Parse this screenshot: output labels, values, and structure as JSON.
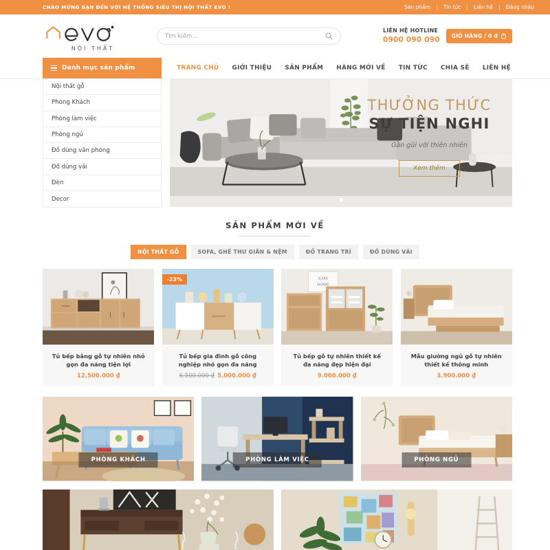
{
  "topbar": {
    "welcome": "CHÀO MỪNG BẠN ĐẾN VỚI HỆ THỐNG SIÊU THỊ NỘI THẤT EVO !",
    "links": [
      "Sản phẩm",
      "Tin tức",
      "Liên hệ",
      "Đăng nhập"
    ]
  },
  "header": {
    "logo_text": "evo",
    "logo_sub": "NỘI THẤT",
    "logo_icon": "house-icon",
    "search_placeholder": "Tìm kiếm...",
    "search_value": "",
    "search_icon": "search-icon",
    "hotline_label": "LIÊN HỆ HOTLINE",
    "hotline_number": "0900 090 090",
    "cart_label": "GIỎ HÀNG / 0 đ",
    "cart_icon": "shopping-bag-icon"
  },
  "sidebar": {
    "title": "Danh mục sản phẩm",
    "menu_icon": "hamburger-icon",
    "items": [
      "Nội thất gỗ",
      "Phòng Khách",
      "Phòng làm việc",
      "Phòng ngủ",
      "Đồ dùng văn phòng",
      "Đồ dùng vải",
      "Đèn",
      "Decor"
    ]
  },
  "nav": {
    "items": [
      {
        "label": "TRANG CHỦ",
        "active": true
      },
      {
        "label": "GIỚI THIỆU",
        "active": false
      },
      {
        "label": "SẢN PHẨM",
        "active": false
      },
      {
        "label": "HÀNG MỚI VỀ",
        "active": false
      },
      {
        "label": "TIN TỨC",
        "active": false
      },
      {
        "label": "CHIA SẺ",
        "active": false
      },
      {
        "label": "LIÊN HỆ",
        "active": false
      }
    ]
  },
  "banner": {
    "title_line1": "THƯỞNG THỨC",
    "title_line2": "SỰ TIỆN NGHI",
    "subtitle": "Gần gũi với thiên nhiên",
    "button_label": "Xem thêm",
    "dots_total": 1,
    "dots_active": 1
  },
  "section": {
    "title": "SẢN PHẨM MỚI VỀ",
    "tabs": [
      {
        "label": "NỘI THẤT GỖ",
        "active": true
      },
      {
        "label": "SOFA, GHẾ THƯ GIÃN & NỆM",
        "active": false
      },
      {
        "label": "ĐỒ TRANG TRÍ",
        "active": false
      },
      {
        "label": "ĐỒ DÙNG VẢI",
        "active": false
      }
    ]
  },
  "products": [
    {
      "name": "Tủ bếp bằng gỗ tự nhiên nhỏ gọn đa năng tiện lợi",
      "price": "12.500.000 ₫",
      "old_price": "",
      "badge": ""
    },
    {
      "name": "Tủ bếp gia đình gỗ công nghiệp nhỏ gọn đa năng",
      "price": "5.000.000 ₫",
      "old_price": "6.500.000 ₫",
      "badge": "-23%"
    },
    {
      "name": "Tủ bếp gỗ tự nhiên thiết kế đa năng đẹp hiện đại",
      "price": "9.000.000 ₫",
      "old_price": "",
      "badge": ""
    },
    {
      "name": "Mẫu giường ngủ gỗ tự nhiên thiết kế thông minh",
      "price": "3.900.000 ₫",
      "old_price": "",
      "badge": ""
    }
  ],
  "categories": [
    {
      "label": "PHÒNG KHÁCH"
    },
    {
      "label": "PHÒNG LÀM VIỆC"
    },
    {
      "label": "PHÒNG NGỦ"
    }
  ],
  "colors": {
    "brand_orange": "#ef9042",
    "badge_orange": "#ef7f2e",
    "banner_gold": "#c19a5b",
    "text_dark": "#3d3d3d"
  }
}
